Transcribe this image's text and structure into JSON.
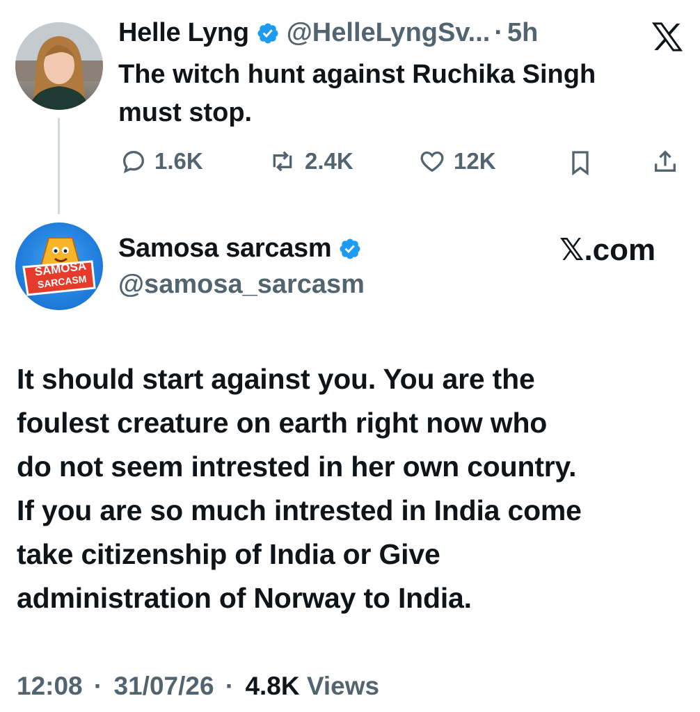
{
  "parent_tweet": {
    "author_name": "Helle Lyng",
    "handle": "@HelleLyngSv...",
    "separator": "·",
    "time": "5h",
    "text_line1": "The witch hunt against Ruchika Singh",
    "text_line2": "must stop.",
    "replies": "1.6K",
    "reposts": "2.4K",
    "likes": "12K"
  },
  "reply_tweet": {
    "author_name": "Samosa sarcasm",
    "handle": "@samosa_sarcasm",
    "avatar_text_1": "SAMOSA",
    "avatar_text_2": "SARCASM",
    "brand": "𝕏.com",
    "text_lines": [
      "It should start against you. You are the",
      "foulest creature on earth right now who",
      "do not seem intrested in her own country.",
      "If you are so much intrested in India come",
      "take citizenship of India or Give",
      "administration of Norway to India."
    ],
    "time": "12:08",
    "dot1": "·",
    "date": "31/07/26",
    "dot2": "·",
    "views_count": "4.8K",
    "views_label": "Views"
  },
  "colors": {
    "text": "#0f1419",
    "secondary": "#536471",
    "verified": "#1d9bf0",
    "thread_line": "#cfd9de"
  },
  "icons": [
    "verified-badge-icon",
    "x-logo-icon",
    "reply-icon",
    "repost-icon",
    "like-icon",
    "bookmark-icon",
    "share-icon"
  ]
}
